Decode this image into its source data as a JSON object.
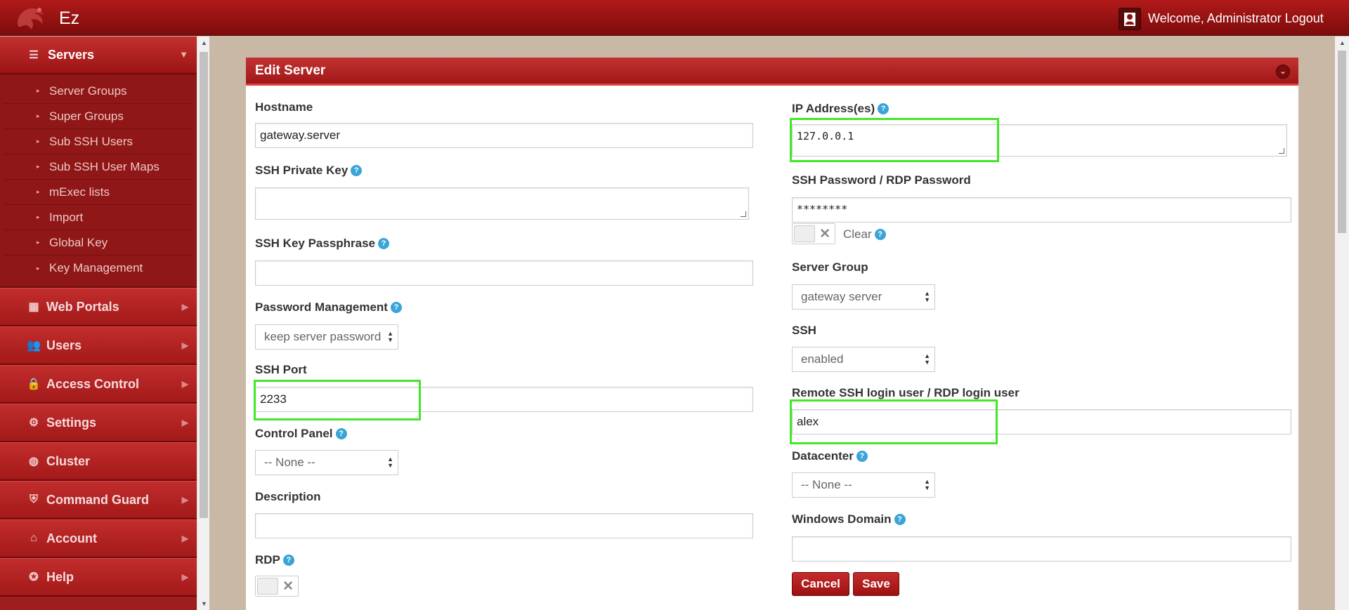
{
  "app": {
    "brand": "Ez",
    "welcome": "Welcome, Administrator Logout"
  },
  "sidebar": {
    "servers": {
      "label": "Servers",
      "icon": "list-icon"
    },
    "sub_items": [
      "Server Groups",
      "Super Groups",
      "Sub SSH Users",
      "Sub SSH User Maps",
      "mExec lists",
      "Import",
      "Global Key",
      "Key Management"
    ],
    "items": [
      {
        "label": "Web Portals",
        "icon": "dashboard-icon"
      },
      {
        "label": "Users",
        "icon": "users-icon"
      },
      {
        "label": "Access Control",
        "icon": "lock-icon"
      },
      {
        "label": "Settings",
        "icon": "gears-icon"
      },
      {
        "label": "Cluster",
        "icon": "globe-icon"
      },
      {
        "label": "Command Guard",
        "icon": "shield-icon"
      },
      {
        "label": "Account",
        "icon": "home-icon"
      },
      {
        "label": "Help",
        "icon": "lifebuoy-icon"
      }
    ]
  },
  "panel": {
    "title": "Edit Server"
  },
  "form": {
    "hostname": {
      "label": "Hostname",
      "value": "gateway.server"
    },
    "ssh_private_key": {
      "label": "SSH Private Key",
      "value": ""
    },
    "ssh_key_passphrase": {
      "label": "SSH Key Passphrase",
      "value": ""
    },
    "password_management": {
      "label": "Password Management",
      "value": "keep server password"
    },
    "ssh_port": {
      "label": "SSH Port",
      "value": "2233"
    },
    "control_panel": {
      "label": "Control Panel",
      "value": "-- None --"
    },
    "description": {
      "label": "Description",
      "value": ""
    },
    "rdp": {
      "label": "RDP"
    },
    "ip_addresses": {
      "label": "IP Address(es)",
      "value": "127.0.0.1"
    },
    "ssh_password": {
      "label": "SSH Password / RDP Password",
      "value": "********",
      "clear_label": "Clear"
    },
    "server_group": {
      "label": "Server Group",
      "value": "gateway server"
    },
    "ssh": {
      "label": "SSH",
      "value": "enabled"
    },
    "remote_login": {
      "label": "Remote SSH login user / RDP login user",
      "value": "alex"
    },
    "datacenter": {
      "label": "Datacenter",
      "value": "-- None --"
    },
    "windows_domain": {
      "label": "Windows Domain",
      "value": ""
    }
  },
  "buttons": {
    "cancel": "Cancel",
    "save": "Save"
  },
  "colors": {
    "accent": "#a81c1c",
    "highlight": "#42e826",
    "help": "#3aa4d8"
  }
}
